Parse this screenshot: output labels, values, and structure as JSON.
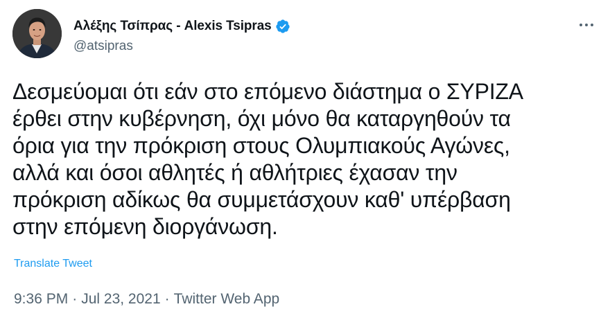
{
  "author": {
    "display_name": "Αλέξης Τσίπρας - Alexis Tsipras",
    "handle": "@atsipras",
    "verified": true,
    "avatar_icon": "person-portrait"
  },
  "header": {
    "more_icon": "more-horizontal-icon"
  },
  "tweet": {
    "lines": [
      "Δεσμεύομαι ότι εάν στο επόμενο διάστημα ο ΣΥΡΙΖΑ",
      "έρθει στην κυβέρνηση, όχι μόνο θα καταργηθούν τα",
      "όρια για την πρόκριση στους Ολυμπιακούς Αγώνες,",
      "αλλά και όσοι αθλητές ή αθλήτριες έχασαν την",
      "πρόκριση αδίκως θα συμμετάσχουν καθ' υπέρβαση",
      "στην επόμενη διοργάνωση."
    ],
    "translate_label": "Translate Tweet"
  },
  "meta": {
    "time": "9:36 PM",
    "date": "Jul 23, 2021",
    "source": "Twitter Web App",
    "separator": "·"
  },
  "colors": {
    "text": "#0f1419",
    "secondary": "#536471",
    "link": "#1d9bf0",
    "verified": "#1d9bf0"
  }
}
